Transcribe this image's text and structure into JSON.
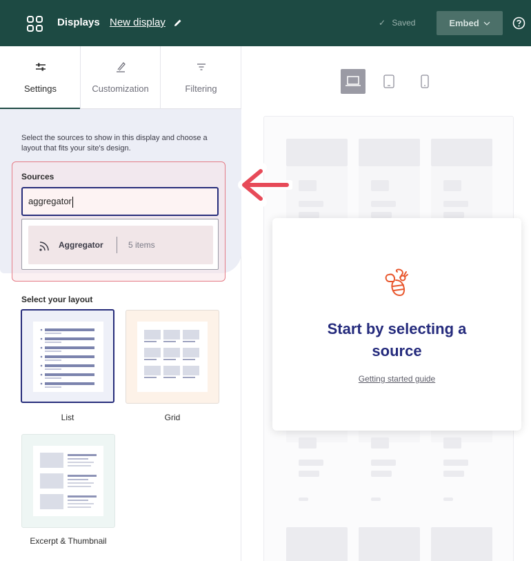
{
  "header": {
    "app_name": "Displays",
    "display_name": "New display",
    "status": "Saved",
    "embed_label": "Embed"
  },
  "tabs": [
    {
      "label": "Settings",
      "active": true
    },
    {
      "label": "Customization",
      "active": false
    },
    {
      "label": "Filtering",
      "active": false
    }
  ],
  "settings": {
    "intro": "Select the sources to show in this display and choose a layout that fits your site's design.",
    "sources_label": "Sources",
    "search_value": "aggregator",
    "option": {
      "name": "Aggregator",
      "count": "5 items",
      "icon": "rss-icon"
    },
    "layout_label": "Select your layout",
    "layouts": [
      {
        "name": "List",
        "selected": true
      },
      {
        "name": "Grid",
        "selected": false
      },
      {
        "name": "Excerpt & Thumbnail",
        "selected": false
      }
    ]
  },
  "preview": {
    "devices": [
      "desktop",
      "tablet",
      "mobile"
    ],
    "selected_device": "desktop",
    "title": "Start by selecting a source",
    "link": "Getting started guide"
  },
  "colors": {
    "topbar": "#1d4a43",
    "accent": "#262c7a",
    "highlight": "#e57b86",
    "bee": "#e8562c"
  }
}
